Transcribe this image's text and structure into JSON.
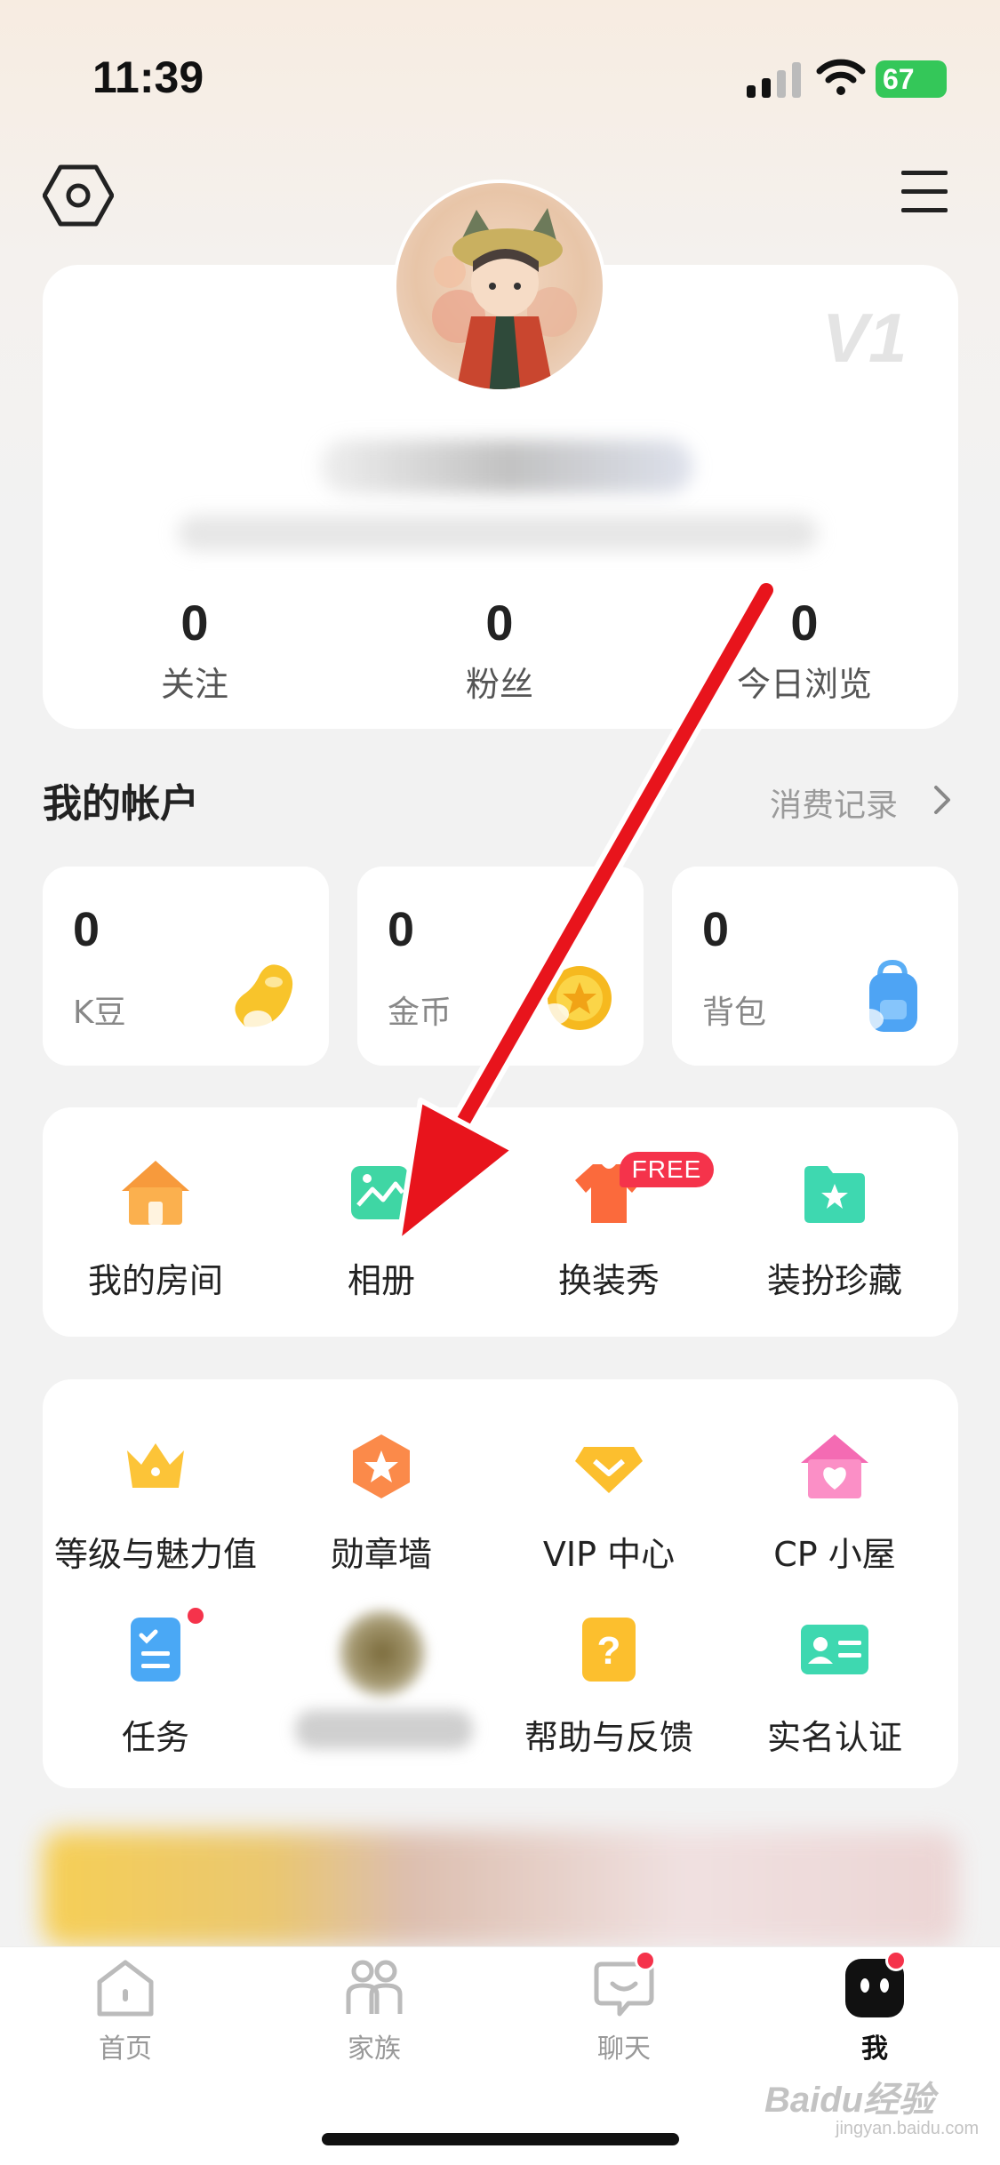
{
  "status_bar": {
    "time": "11:39",
    "battery": "67"
  },
  "profile": {
    "level_badge": "V1",
    "stats": [
      {
        "value": "0",
        "label": "关注"
      },
      {
        "value": "0",
        "label": "粉丝"
      },
      {
        "value": "0",
        "label": "今日浏览"
      }
    ]
  },
  "account": {
    "title": "我的帐户",
    "history_link": "消费记录",
    "cards": [
      {
        "value": "0",
        "label": "K豆",
        "icon": "bean-icon"
      },
      {
        "value": "0",
        "label": "金币",
        "icon": "coin-icon"
      },
      {
        "value": "0",
        "label": "背包",
        "icon": "backpack-icon"
      }
    ]
  },
  "quick_grid": {
    "items": [
      {
        "label": "我的房间",
        "icon": "house-icon"
      },
      {
        "label": "相册",
        "icon": "album-icon"
      },
      {
        "label": "换装秀",
        "icon": "shirt-icon",
        "badge": "FREE"
      },
      {
        "label": "装扮珍藏",
        "icon": "folder-star-icon"
      }
    ]
  },
  "features": {
    "row1": [
      {
        "label": "等级与魅力值",
        "icon": "crown-icon"
      },
      {
        "label": "勋章墙",
        "icon": "medal-icon"
      },
      {
        "label": "VIP 中心",
        "icon": "vip-diamond-icon"
      },
      {
        "label": "CP 小屋",
        "icon": "heart-house-icon"
      }
    ],
    "row2": [
      {
        "label": "任务",
        "icon": "task-icon",
        "has_dot": true
      },
      {
        "label": "",
        "icon": "blurred-icon"
      },
      {
        "label": "帮助与反馈",
        "icon": "help-icon"
      },
      {
        "label": "实名认证",
        "icon": "id-card-icon"
      }
    ]
  },
  "tabbar": {
    "tabs": [
      {
        "label": "首页",
        "icon": "home-icon",
        "active": false
      },
      {
        "label": "家族",
        "icon": "family-icon",
        "active": false
      },
      {
        "label": "聊天",
        "icon": "chat-icon",
        "active": false,
        "has_dot": true
      },
      {
        "label": "我",
        "icon": "me-icon",
        "active": true,
        "has_dot": true
      }
    ]
  },
  "watermark": {
    "text": "Baidu经验",
    "sub": "jingyan.baidu.com"
  },
  "colors": {
    "accent_red": "#f5334b",
    "annotation_red": "#e8141c",
    "battery_green": "#34c759"
  }
}
